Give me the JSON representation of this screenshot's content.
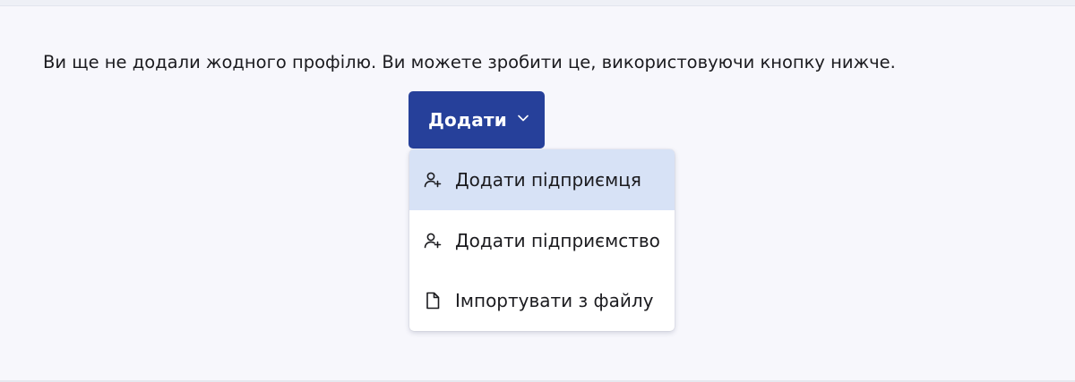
{
  "message": "Ви ще не додали жодного профілю. Ви можете зробити це, використовуючи кнопку нижче.",
  "add_button": {
    "label": "Додати",
    "icon": "chevron-down-icon"
  },
  "menu": {
    "items": [
      {
        "label": "Додати підприємця",
        "icon": "user-plus-icon",
        "highlighted": true
      },
      {
        "label": "Додати підприємство",
        "icon": "user-plus-icon",
        "highlighted": false
      },
      {
        "label": "Імпортувати з файлу",
        "icon": "file-icon",
        "highlighted": false
      }
    ]
  },
  "colors": {
    "button": "#26409a",
    "highlight": "#d7e2f6",
    "background": "#f7f7fc"
  }
}
